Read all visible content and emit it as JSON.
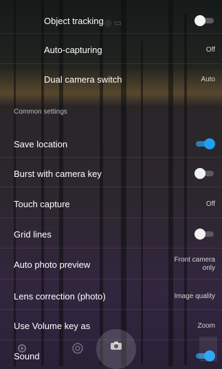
{
  "settings": {
    "object_tracking": {
      "label": "Object tracking",
      "state": "off"
    },
    "auto_capturing": {
      "label": "Auto-capturing",
      "value": "Off"
    },
    "dual_camera_switch": {
      "label": "Dual camera switch",
      "value": "Auto"
    },
    "common_header": "Common settings",
    "save_location": {
      "label": "Save location",
      "state": "on"
    },
    "burst_with_camera_key": {
      "label": "Burst with camera key",
      "state": "off"
    },
    "touch_capture": {
      "label": "Touch capture",
      "value": "Off"
    },
    "grid_lines": {
      "label": "Grid lines",
      "state": "off"
    },
    "auto_photo_preview": {
      "label": "Auto photo preview",
      "value_line1": "Front camera",
      "value_line2": "only"
    },
    "lens_correction": {
      "label": "Lens correction (photo)",
      "value": "Image quality"
    },
    "use_volume_key": {
      "label": "Use Volume key as",
      "value": "Zoom"
    },
    "sound": {
      "label": "Sound",
      "state": "on"
    }
  },
  "colors": {
    "toggle_on": "#1da1f2",
    "toggle_off": "#f2f2f2"
  },
  "icons": [
    "settings-icon",
    "camera-mode-icon",
    "shutter-camera-icon",
    "mode-icons"
  ]
}
